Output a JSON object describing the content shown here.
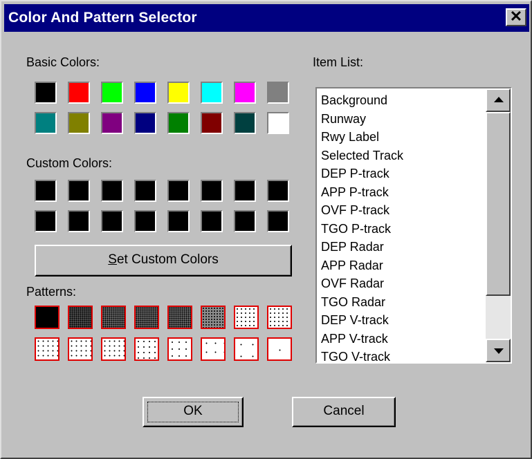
{
  "window": {
    "title": "Color And Pattern Selector",
    "close_glyph": "✕"
  },
  "basic_colors": {
    "label": "Basic Colors:",
    "swatches": [
      "#000000",
      "#ff0000",
      "#00ff00",
      "#0000ff",
      "#ffff00",
      "#00ffff",
      "#ff00ff",
      "#808080",
      "#008080",
      "#808000",
      "#800080",
      "#000080",
      "#008000",
      "#800000",
      "#004040",
      "#ffffff"
    ]
  },
  "custom_colors": {
    "label": "Custom Colors:",
    "swatches": [
      "#000000",
      "#000000",
      "#000000",
      "#000000",
      "#000000",
      "#000000",
      "#000000",
      "#000000",
      "#000000",
      "#000000",
      "#000000",
      "#000000",
      "#000000",
      "#000000",
      "#000000",
      "#000000"
    ],
    "button_label_underlined": "S",
    "button_label_rest": "et Custom Colors"
  },
  "patterns": {
    "label": "Patterns:",
    "border_color": "#e00000",
    "densities": [
      1,
      0.7,
      0.6,
      0.6,
      0.6,
      0.45,
      0.35,
      0.35,
      0.3,
      0.3,
      0.3,
      0.25,
      0.2,
      0.15,
      0.12,
      0.06
    ]
  },
  "item_list": {
    "label": "Item List:",
    "items": [
      "Background",
      "Runway",
      "Rwy Label",
      "Selected Track",
      "DEP P-track",
      "APP P-track",
      "OVF P-track",
      "TGO P-track",
      "DEP Radar",
      "APP Radar",
      "OVF Radar",
      "TGO Radar",
      "DEP V-track",
      "APP V-track",
      "TGO V-track"
    ]
  },
  "buttons": {
    "ok": "OK",
    "cancel": "Cancel"
  }
}
